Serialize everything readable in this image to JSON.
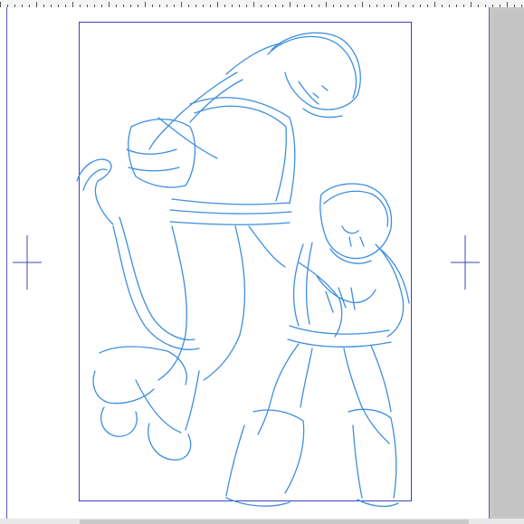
{
  "canvas": {
    "paper_color": "#ffffff",
    "guide_color": "#3a44b8",
    "sketch_color": "#3d8ee0",
    "background_color": "#c8c8c8"
  },
  "icons": {
    "registration_mark": "crosshair",
    "artwork": "pencil-sketch"
  }
}
